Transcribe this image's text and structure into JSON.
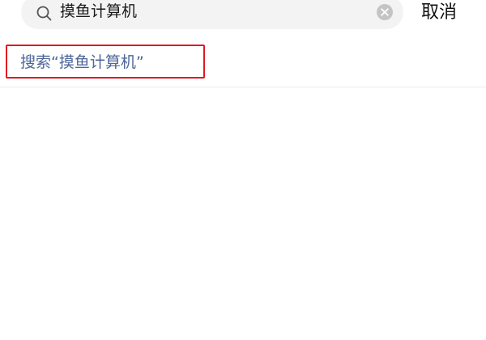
{
  "search": {
    "query": "摸鱼计算机",
    "icon": "search-icon",
    "clear_icon": "clear-icon",
    "cancel_label": "取消"
  },
  "suggestion": {
    "label": "搜索“摸鱼计算机”"
  },
  "colors": {
    "suggestion_text": "#4d6699",
    "highlight_border": "#e0191f",
    "search_box_bg": "#f3f3f3"
  }
}
